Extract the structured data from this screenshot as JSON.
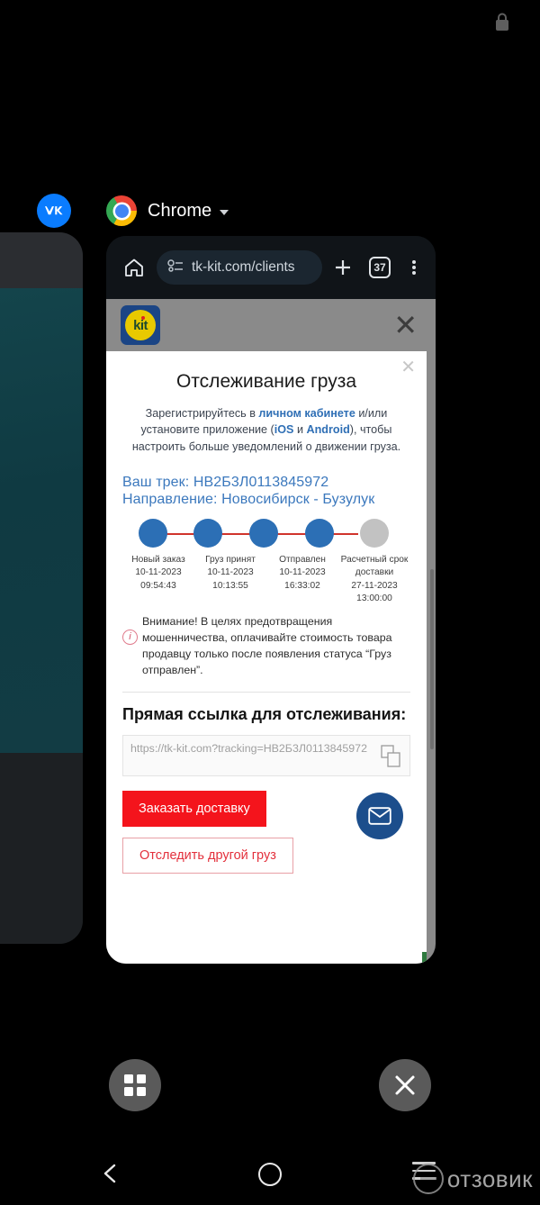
{
  "recents": {
    "left_app": {
      "name": "VK",
      "icon": "vk-icon"
    },
    "chrome_card": {
      "app_name": "Chrome",
      "caret_icon": "chevron-down-icon",
      "lock_icon": "lock-icon"
    },
    "grid_button_label": "Grid view",
    "grid_icon": "grid-icon",
    "close_all_label": "Close all",
    "close_all_icon": "close-icon"
  },
  "omnibox": {
    "home_icon": "home-icon",
    "site_info_icon": "page-info-icon",
    "url": "tk-kit.com/clients",
    "new_tab_icon": "plus-icon",
    "tab_count": "37",
    "menu_icon": "overflow-menu-icon"
  },
  "site": {
    "logo_text": "kit",
    "logo_colors": {
      "square": "#1b4585",
      "disc": "#e8c900",
      "text": "#1d4a2d",
      "dot": "#e02020"
    },
    "close_icon": "close-icon"
  },
  "modal": {
    "close_icon": "close-icon",
    "title": "Отслеживание груза",
    "subtitle": {
      "part1": "Зарегистрируйтесь в ",
      "link_cabinet": "личном кабинете",
      "part2": " и/или установите приложение (",
      "link_ios": "iOS",
      "part3": " и ",
      "link_android": "Android",
      "part4": "), чтобы настроить больше уведомлений о движении груза."
    },
    "track_line": "Ваш трек: НВ2Б3Л0113845972",
    "direction_line": "Направление: Новосибирск - Бузулук",
    "steps": [
      {
        "label": "Новый заказ",
        "date": "10-11-2023",
        "time": "09:54:43",
        "state": "done"
      },
      {
        "label": "Груз принят",
        "date": "10-11-2023",
        "time": "10:13:55",
        "state": "done"
      },
      {
        "label": "Отправлен",
        "date": "10-11-2023",
        "time": "16:33:02",
        "state": "done"
      },
      {
        "label": "Расчетный срок доставки",
        "date": "27-11-2023",
        "time": "13:00:00",
        "state": "done"
      },
      {
        "label": "",
        "date": "",
        "time": "",
        "state": "pending"
      }
    ],
    "step_colors": {
      "active": "#2c6fb5",
      "pending": "#c2c2c2",
      "rail": "#d0342c",
      "dash": "#9a9a9a"
    },
    "warning_icon": "info-icon",
    "warning_text": "Внимание! В целях предотвращения мошенничества, оплачивайте стоимость товара продавцу только после появления статуса “Груз отправлен”.",
    "link_heading": "Прямая ссылка для отслеживания:",
    "link_url": "https://tk-kit.com?tracking=НВ2Б3Л0113845972",
    "copy_icon": "copy-icon",
    "order_button": "Заказать доставку",
    "track_other_button": "Отследить другой груз",
    "fab_icon": "mail-icon",
    "accent_red": "#f4141c",
    "accent_blue": "#2f6fb5"
  },
  "navbar": {
    "back_icon": "chevron-left-icon",
    "home_icon": "circle-home-icon",
    "recents_icon": "recents-icon"
  },
  "watermark": {
    "text": "отзовик",
    "icon": "otzovik-logo-icon"
  }
}
